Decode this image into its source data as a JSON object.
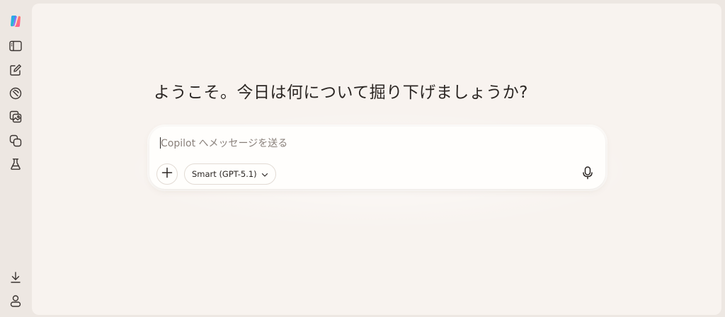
{
  "sidebar": {
    "top_items": [
      {
        "icon": "copilot-logo-icon"
      },
      {
        "icon": "sidebar-toggle-icon"
      },
      {
        "icon": "new-chat-icon"
      },
      {
        "icon": "discover-icon"
      },
      {
        "icon": "image-gallery-icon"
      },
      {
        "icon": "copy-pages-icon"
      },
      {
        "icon": "labs-flask-icon"
      }
    ],
    "bottom_items": [
      {
        "icon": "download-icon"
      },
      {
        "icon": "profile-icon"
      }
    ]
  },
  "main": {
    "headline": "ようこそ。今日は何について掘り下げましょうか?",
    "composer": {
      "placeholder": "Copilot へメッセージを送る",
      "value": "",
      "add_icon": "plus-icon",
      "model_label": "Smart (GPT-5.1)",
      "model_icon": "chevron-down-icon",
      "mic_icon": "microphone-icon"
    }
  },
  "colors": {
    "sidebar_bg": "#ede7e2",
    "main_bg": "#f8f3ef",
    "composer_bg": "#fffefc",
    "text_primary": "#2b2623",
    "text_placeholder": "#8a817b",
    "icon": "#3a3431"
  }
}
